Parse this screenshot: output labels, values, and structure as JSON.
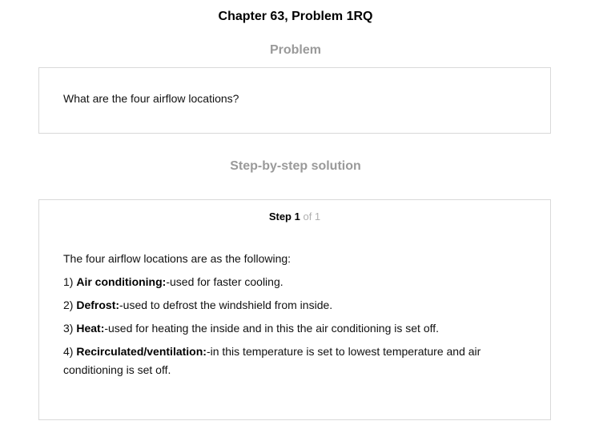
{
  "header": {
    "title": "Chapter 63, Problem 1RQ"
  },
  "problem": {
    "heading": "Problem",
    "text": "What are the four airflow locations?"
  },
  "solution": {
    "heading": "Step-by-step solution",
    "step": {
      "label": "Step 1",
      "of": "of 1"
    },
    "intro": "The four airflow locations are as the following:",
    "items": [
      {
        "num": "1)",
        "term": "Air conditioning:",
        "desc": "-used for faster cooling."
      },
      {
        "num": "2)",
        "term": "Defrost:",
        "desc": "-used to defrost the windshield from inside."
      },
      {
        "num": "3)",
        "term": "Heat:",
        "desc": "-used for heating the inside and in this the air conditioning is set off."
      },
      {
        "num": "4)",
        "term": "Recirculated/ventilation:",
        "desc": "-in this temperature is set to lowest temperature and air conditioning is set off."
      }
    ]
  }
}
